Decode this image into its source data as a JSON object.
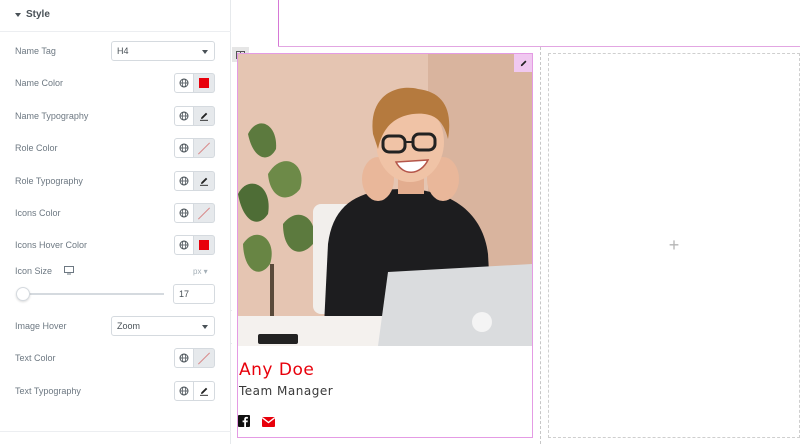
{
  "panel": {
    "section_title": "Style",
    "rows": {
      "name_tag": {
        "label": "Name Tag",
        "value": "H4"
      },
      "name_color": {
        "label": "Name Color",
        "color": "#e8000b"
      },
      "name_typography": {
        "label": "Name Typography"
      },
      "role_color": {
        "label": "Role Color",
        "color": "unset"
      },
      "role_typography": {
        "label": "Role Typography"
      },
      "icons_color": {
        "label": "Icons Color",
        "color": "unset"
      },
      "icons_hover_color": {
        "label": "Icons Hover Color",
        "color": "#e8000b"
      },
      "icon_size": {
        "label": "Icon Size",
        "unit": "px",
        "value": "17"
      },
      "image_hover": {
        "label": "Image Hover",
        "value": "Zoom"
      },
      "text_color": {
        "label": "Text Color",
        "color": "unset"
      },
      "text_typography": {
        "label": "Text Typography"
      }
    }
  },
  "canvas": {
    "member": {
      "name": "Any Doe",
      "role": "Team Manager"
    },
    "icons": [
      "facebook-icon",
      "envelope-icon"
    ],
    "empty_column_symbol": "+"
  },
  "colors": {
    "accent_red": "#e8000b",
    "selection_pink": "#e49be4"
  }
}
